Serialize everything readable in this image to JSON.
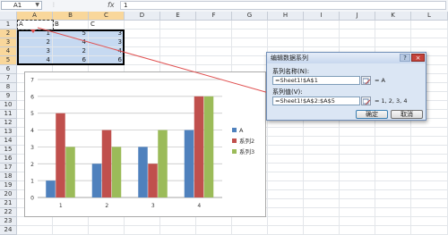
{
  "formula_bar": {
    "name_box": "A1",
    "fx_label": "fx",
    "formula": "1"
  },
  "columns": [
    "A",
    "B",
    "C",
    "D",
    "E",
    "F",
    "G",
    "H",
    "I",
    "J",
    "K",
    "L"
  ],
  "rows": [
    "1",
    "2",
    "3",
    "4",
    "5",
    "6",
    "7",
    "8",
    "9",
    "10",
    "11",
    "12",
    "13",
    "14",
    "15",
    "16",
    "17",
    "18",
    "19",
    "20",
    "21",
    "22",
    "23",
    "24"
  ],
  "sheet": {
    "header_cells": [
      "A",
      "B",
      "C"
    ],
    "data_rows": [
      [
        "1",
        "5",
        "3"
      ],
      [
        "2",
        "4",
        "3"
      ],
      [
        "3",
        "2",
        "4"
      ],
      [
        "4",
        "6",
        "6"
      ]
    ]
  },
  "chart_data": {
    "type": "bar",
    "categories": [
      "1",
      "2",
      "3",
      "4"
    ],
    "series": [
      {
        "name": "A",
        "values": [
          1,
          2,
          3,
          4
        ],
        "color": "#4f81bd"
      },
      {
        "name": "系列2",
        "values": [
          5,
          4,
          2,
          6
        ],
        "color": "#c0504d"
      },
      {
        "name": "系列3",
        "values": [
          3,
          3,
          4,
          6
        ],
        "color": "#9bbb59"
      }
    ],
    "ylim": [
      0,
      7
    ],
    "yticks": [
      "0",
      "1",
      "2",
      "3",
      "4",
      "5",
      "6",
      "7"
    ],
    "grid": true,
    "legend": "right"
  },
  "dialog": {
    "title": "编辑数据系列",
    "help": "?",
    "close": "×",
    "series_name_label": "系列名称(N):",
    "series_name_value": "=Sheet1!$A$1",
    "series_name_preview": "= A",
    "series_values_label": "系列值(V):",
    "series_values_value": "=Sheet1!$A$2:$A$5",
    "series_values_preview": "= 1, 2, 3, 4",
    "ok_label": "确定",
    "cancel_label": "取消"
  },
  "colors": {
    "selection_fill": "#c6d9f1",
    "header_highlight": "#f9d79b",
    "arrow": "#e05050"
  }
}
